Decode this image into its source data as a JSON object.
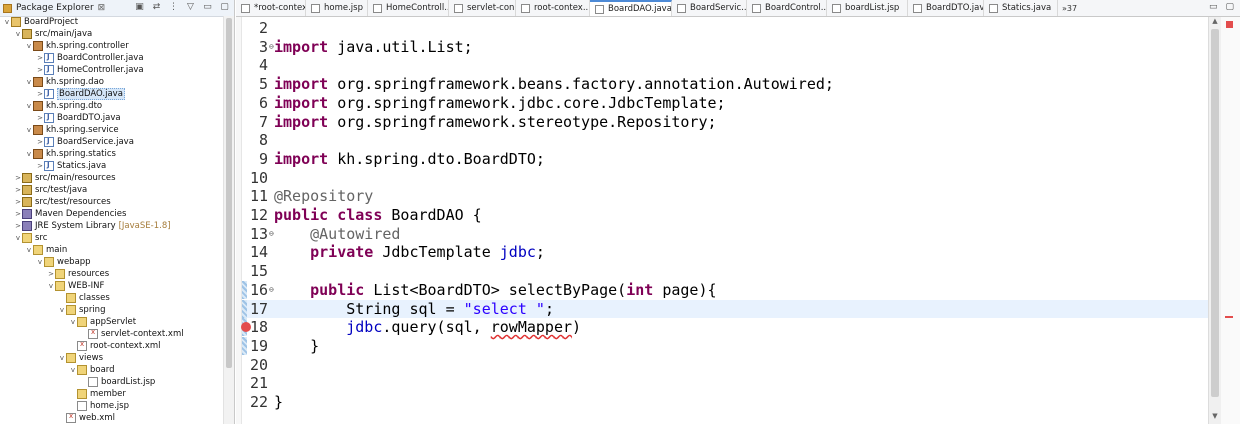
{
  "explorer": {
    "title": "Package Explorer",
    "title_suffix": "⊠",
    "tree": [
      {
        "label": "BoardProject",
        "depth": 0,
        "twisty": "v",
        "icon": "project"
      },
      {
        "label": "src/main/java",
        "depth": 1,
        "twisty": "v",
        "icon": "src"
      },
      {
        "label": "kh.spring.controller",
        "depth": 2,
        "twisty": "v",
        "icon": "package"
      },
      {
        "label": "BoardController.java",
        "depth": 3,
        "twisty": ">",
        "icon": "java"
      },
      {
        "label": "HomeController.java",
        "depth": 3,
        "twisty": ">",
        "icon": "java"
      },
      {
        "label": "kh.spring.dao",
        "depth": 2,
        "twisty": "v",
        "icon": "package"
      },
      {
        "label": "BoardDAO.java",
        "depth": 3,
        "twisty": ">",
        "icon": "java",
        "selected": true
      },
      {
        "label": "kh.spring.dto",
        "depth": 2,
        "twisty": "v",
        "icon": "package"
      },
      {
        "label": "BoardDTO.java",
        "depth": 3,
        "twisty": ">",
        "icon": "java"
      },
      {
        "label": "kh.spring.service",
        "depth": 2,
        "twisty": "v",
        "icon": "package"
      },
      {
        "label": "BoardService.java",
        "depth": 3,
        "twisty": ">",
        "icon": "java"
      },
      {
        "label": "kh.spring.statics",
        "depth": 2,
        "twisty": "v",
        "icon": "package"
      },
      {
        "label": "Statics.java",
        "depth": 3,
        "twisty": ">",
        "icon": "java"
      },
      {
        "label": "src/main/resources",
        "depth": 1,
        "twisty": ">",
        "icon": "src"
      },
      {
        "label": "src/test/java",
        "depth": 1,
        "twisty": ">",
        "icon": "src"
      },
      {
        "label": "src/test/resources",
        "depth": 1,
        "twisty": ">",
        "icon": "src"
      },
      {
        "label": "Maven Dependencies",
        "depth": 1,
        "twisty": ">",
        "icon": "lib"
      },
      {
        "label": "JRE System Library",
        "suffix": "[JavaSE-1.8]",
        "depth": 1,
        "twisty": ">",
        "icon": "lib"
      },
      {
        "label": "src",
        "depth": 1,
        "twisty": "v",
        "icon": "folder"
      },
      {
        "label": "main",
        "depth": 2,
        "twisty": "v",
        "icon": "folder"
      },
      {
        "label": "webapp",
        "depth": 3,
        "twisty": "v",
        "icon": "folder"
      },
      {
        "label": "resources",
        "depth": 4,
        "twisty": ">",
        "icon": "folder"
      },
      {
        "label": "WEB-INF",
        "depth": 4,
        "twisty": "v",
        "icon": "folder"
      },
      {
        "label": "classes",
        "depth": 5,
        "twisty": "",
        "icon": "folder"
      },
      {
        "label": "spring",
        "depth": 5,
        "twisty": "v",
        "icon": "folder"
      },
      {
        "label": "appServlet",
        "depth": 6,
        "twisty": "v",
        "icon": "folder"
      },
      {
        "label": "servlet-context.xml",
        "depth": 7,
        "twisty": "",
        "icon": "xml"
      },
      {
        "label": "root-context.xml",
        "depth": 6,
        "twisty": "",
        "icon": "xml"
      },
      {
        "label": "views",
        "depth": 5,
        "twisty": "v",
        "icon": "folder"
      },
      {
        "label": "board",
        "depth": 6,
        "twisty": "v",
        "icon": "folder"
      },
      {
        "label": "boardList.jsp",
        "depth": 7,
        "twisty": "",
        "icon": "jsp"
      },
      {
        "label": "member",
        "depth": 6,
        "twisty": "",
        "icon": "folder"
      },
      {
        "label": "home.jsp",
        "depth": 6,
        "twisty": "",
        "icon": "jsp"
      },
      {
        "label": "web.xml",
        "depth": 5,
        "twisty": "",
        "icon": "xml"
      }
    ]
  },
  "editor_tabs": [
    {
      "label": "*root-contex...",
      "icon": "xml",
      "active": false
    },
    {
      "label": "home.jsp",
      "icon": "jsp",
      "active": false
    },
    {
      "label": "HomeControll...",
      "icon": "java",
      "active": false
    },
    {
      "label": "servlet-con...",
      "icon": "xml",
      "active": false
    },
    {
      "label": "root-contex...",
      "icon": "xml",
      "active": false
    },
    {
      "label": "BoardDAO.java",
      "icon": "java",
      "active": true,
      "close": "⊠"
    },
    {
      "label": "BoardServic...",
      "icon": "java",
      "active": false
    },
    {
      "label": "BoardControl...",
      "icon": "java",
      "active": false
    },
    {
      "label": "boardList.jsp",
      "icon": "jsp",
      "active": false
    },
    {
      "label": "BoardDTO.java",
      "icon": "java",
      "active": false
    },
    {
      "label": "Statics.java",
      "icon": "java",
      "active": false
    }
  ],
  "tabs_overflow": "»37",
  "code_lines": [
    {
      "n": "2",
      "fold": "",
      "tokens": []
    },
    {
      "n": "3",
      "fold": "⊖",
      "tokens": [
        {
          "t": "import",
          "c": "kw"
        },
        {
          "t": " java.util.List;"
        }
      ]
    },
    {
      "n": "4",
      "fold": "",
      "tokens": []
    },
    {
      "n": "5",
      "fold": "",
      "tokens": [
        {
          "t": "import",
          "c": "kw"
        },
        {
          "t": " org.springframework.beans.factory.annotation.Autowired;"
        }
      ]
    },
    {
      "n": "6",
      "fold": "",
      "tokens": [
        {
          "t": "import",
          "c": "kw"
        },
        {
          "t": " org.springframework.jdbc.core.JdbcTemplate;"
        }
      ]
    },
    {
      "n": "7",
      "fold": "",
      "tokens": [
        {
          "t": "import",
          "c": "kw"
        },
        {
          "t": " org.springframework.stereotype.Repository;"
        }
      ]
    },
    {
      "n": "8",
      "fold": "",
      "tokens": []
    },
    {
      "n": "9",
      "fold": "",
      "tokens": [
        {
          "t": "import",
          "c": "kw"
        },
        {
          "t": " kh.spring.dto.BoardDTO;"
        }
      ]
    },
    {
      "n": "10",
      "fold": "",
      "tokens": []
    },
    {
      "n": "11",
      "fold": "",
      "tokens": [
        {
          "t": "@Repository",
          "c": "ann"
        }
      ]
    },
    {
      "n": "12",
      "fold": "",
      "tokens": [
        {
          "t": "public",
          "c": "kw"
        },
        {
          "t": " "
        },
        {
          "t": "class",
          "c": "kw"
        },
        {
          "t": " BoardDAO {"
        }
      ]
    },
    {
      "n": "13",
      "fold": "⊖",
      "tokens": [
        {
          "t": "    "
        },
        {
          "t": "@Autowired",
          "c": "ann"
        }
      ]
    },
    {
      "n": "14",
      "fold": "",
      "tokens": [
        {
          "t": "    "
        },
        {
          "t": "private",
          "c": "kw"
        },
        {
          "t": " JdbcTemplate "
        },
        {
          "t": "jdbc",
          "c": "fld"
        },
        {
          "t": ";"
        }
      ]
    },
    {
      "n": "15",
      "fold": "",
      "tokens": []
    },
    {
      "n": "16",
      "fold": "⊖",
      "tokens": [
        {
          "t": "    "
        },
        {
          "t": "public",
          "c": "kw"
        },
        {
          "t": " List<BoardDTO> selectByPage("
        },
        {
          "t": "int",
          "c": "kw"
        },
        {
          "t": " page){"
        }
      ]
    },
    {
      "n": "17",
      "fold": "",
      "current": true,
      "tokens": [
        {
          "t": "        String sql = "
        },
        {
          "t": "\"select \"",
          "c": "str"
        },
        {
          "t": ";"
        }
      ]
    },
    {
      "n": "18",
      "fold": "",
      "error": true,
      "tokens": [
        {
          "t": "        "
        },
        {
          "t": "jdbc",
          "c": "fld"
        },
        {
          "t": ".query(sql, "
        },
        {
          "t": "rowMapper",
          "c": "err"
        },
        {
          "t": ")"
        }
      ]
    },
    {
      "n": "19",
      "fold": "",
      "tokens": [
        {
          "t": "    }"
        }
      ]
    },
    {
      "n": "20",
      "fold": "",
      "tokens": []
    },
    {
      "n": "21",
      "fold": "",
      "tokens": []
    },
    {
      "n": "22",
      "fold": "",
      "tokens": [
        {
          "t": "}"
        }
      ]
    }
  ],
  "window_buttons": {
    "minimize": "▭",
    "maximize": "▢"
  },
  "explorer_tools": [
    "▣",
    "⇄",
    "⋮",
    "▽",
    "▭",
    "▢"
  ]
}
